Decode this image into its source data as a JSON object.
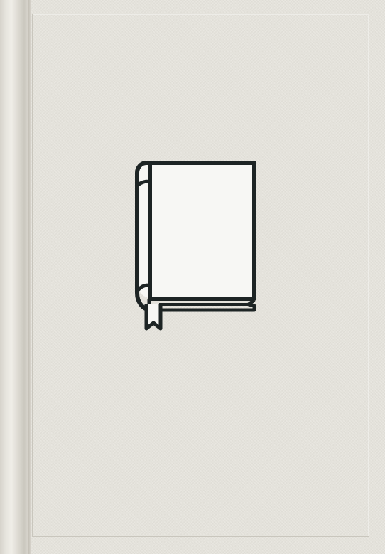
{
  "cover": {
    "background_color": "#e4e2db",
    "frame_color": "#c9c6bd",
    "emblem": {
      "icon": "book-icon",
      "stroke_color": "#1d2424"
    }
  }
}
